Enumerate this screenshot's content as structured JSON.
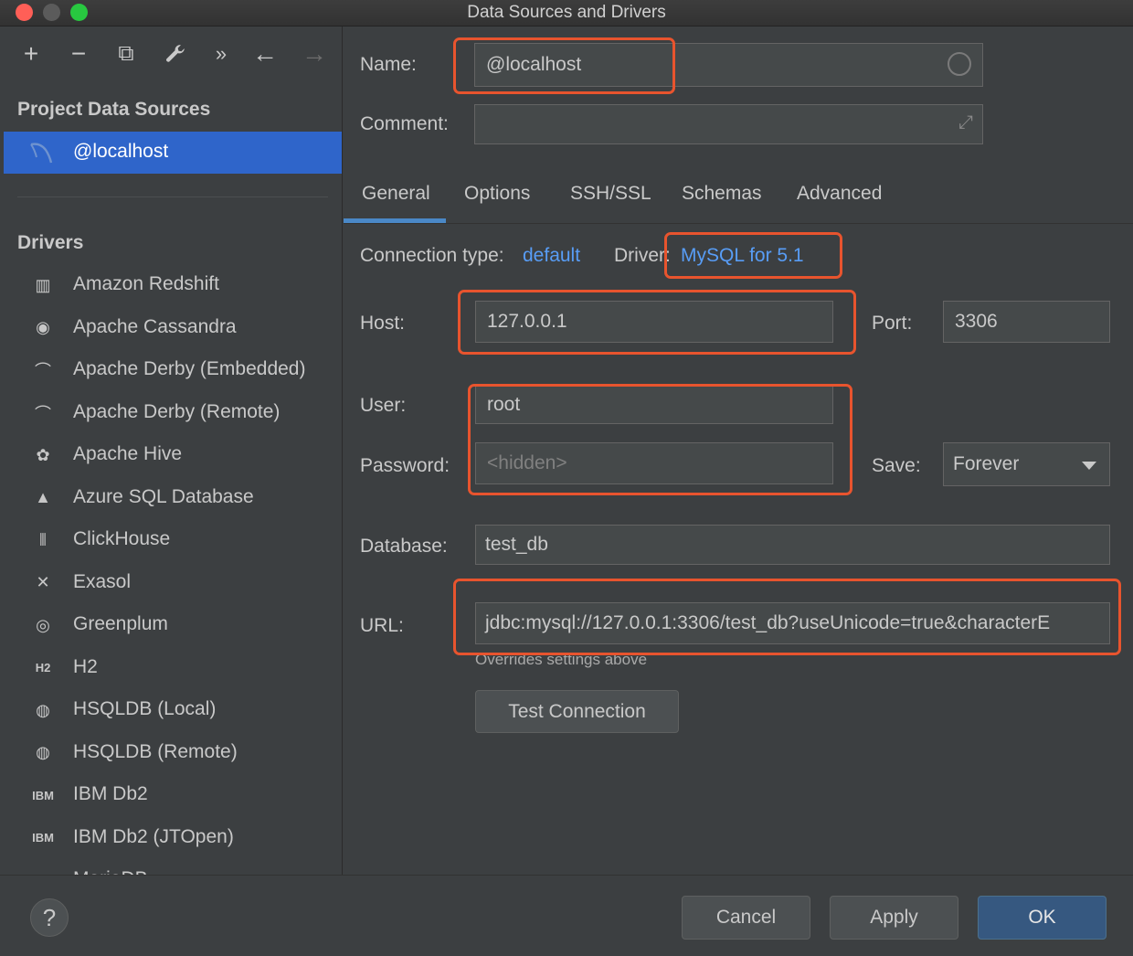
{
  "window": {
    "title": "Data Sources and Drivers"
  },
  "toolbar": {
    "add": "+",
    "remove": "−",
    "duplicate": "⧉",
    "settings": "🔧",
    "more": "»",
    "back": "←",
    "forward": "→"
  },
  "sidebar": {
    "project_title": "Project Data Sources",
    "selected_source": "@localhost",
    "drivers_title": "Drivers",
    "drivers": [
      {
        "label": "Amazon Redshift",
        "icon": "redshift-icon",
        "glyph": "▥"
      },
      {
        "label": "Apache Cassandra",
        "icon": "cassandra-icon",
        "glyph": "◉"
      },
      {
        "label": "Apache Derby (Embedded)",
        "icon": "derby-icon",
        "glyph": "⌒"
      },
      {
        "label": "Apache Derby (Remote)",
        "icon": "derby-icon",
        "glyph": "⌒"
      },
      {
        "label": "Apache Hive",
        "icon": "hive-icon",
        "glyph": "✿"
      },
      {
        "label": "Azure SQL Database",
        "icon": "azure-icon",
        "glyph": "▲"
      },
      {
        "label": "ClickHouse",
        "icon": "clickhouse-icon",
        "glyph": "⦀"
      },
      {
        "label": "Exasol",
        "icon": "exasol-icon",
        "glyph": "✕"
      },
      {
        "label": "Greenplum",
        "icon": "greenplum-icon",
        "glyph": "◎"
      },
      {
        "label": "H2",
        "icon": "h2-icon",
        "glyph": "H2"
      },
      {
        "label": "HSQLDB (Local)",
        "icon": "hsqldb-icon",
        "glyph": "◍"
      },
      {
        "label": "HSQLDB (Remote)",
        "icon": "hsqldb-icon",
        "glyph": "◍"
      },
      {
        "label": "IBM Db2",
        "icon": "ibm-db2-icon",
        "glyph": "IBM"
      },
      {
        "label": "IBM Db2 (JTOpen)",
        "icon": "ibm-db2-icon",
        "glyph": "IBM"
      },
      {
        "label": "MariaDB",
        "icon": "mariadb-icon",
        "glyph": "⌁"
      }
    ]
  },
  "form": {
    "name_label": "Name:",
    "name_value": "@localhost",
    "comment_label": "Comment:",
    "comment_value": "",
    "tabs": [
      "General",
      "Options",
      "SSH/SSL",
      "Schemas",
      "Advanced"
    ],
    "active_tab": "General",
    "connection_type_label": "Connection type:",
    "connection_type_value": "default",
    "driver_label": "Driver:",
    "driver_value": "MySQL for 5.1",
    "host_label": "Host:",
    "host_value": "127.0.0.1",
    "port_label": "Port:",
    "port_value": "3306",
    "user_label": "User:",
    "user_value": "root",
    "password_label": "Password:",
    "password_placeholder": "<hidden>",
    "save_label": "Save:",
    "save_value": "Forever",
    "database_label": "Database:",
    "database_value": "test_db",
    "url_label": "URL:",
    "url_value": "jdbc:mysql://127.0.0.1:3306/test_db?useUnicode=true&characterE",
    "url_hint": "Overrides settings above",
    "test_connection": "Test Connection"
  },
  "footer": {
    "help": "?",
    "cancel": "Cancel",
    "apply": "Apply",
    "ok": "OK"
  },
  "colors": {
    "accent": "#2f65ca",
    "link": "#589df6",
    "highlight": "#e8542e",
    "background": "#3c3f41"
  }
}
